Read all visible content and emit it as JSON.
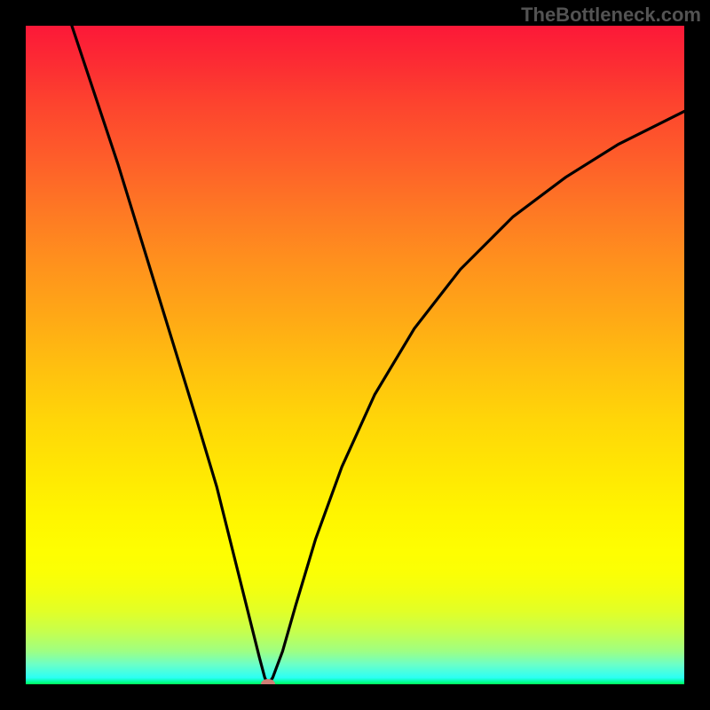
{
  "watermark": "TheBottleneck.com",
  "chart_data": {
    "type": "line",
    "title": "",
    "xlabel": "",
    "ylabel": "",
    "xlim": [
      0,
      100
    ],
    "ylim": [
      0,
      100
    ],
    "curve": [
      {
        "x": 7,
        "y": 100
      },
      {
        "x": 10,
        "y": 91
      },
      {
        "x": 14,
        "y": 79
      },
      {
        "x": 18,
        "y": 66
      },
      {
        "x": 22,
        "y": 53
      },
      {
        "x": 26,
        "y": 40
      },
      {
        "x": 29,
        "y": 30
      },
      {
        "x": 31,
        "y": 22
      },
      {
        "x": 33,
        "y": 14
      },
      {
        "x": 34.5,
        "y": 8
      },
      {
        "x": 35.5,
        "y": 4
      },
      {
        "x": 36.3,
        "y": 1
      },
      {
        "x": 36.8,
        "y": 0
      },
      {
        "x": 37.5,
        "y": 1
      },
      {
        "x": 39,
        "y": 5
      },
      {
        "x": 41,
        "y": 12
      },
      {
        "x": 44,
        "y": 22
      },
      {
        "x": 48,
        "y": 33
      },
      {
        "x": 53,
        "y": 44
      },
      {
        "x": 59,
        "y": 54
      },
      {
        "x": 66,
        "y": 63
      },
      {
        "x": 74,
        "y": 71
      },
      {
        "x": 82,
        "y": 77
      },
      {
        "x": 90,
        "y": 82
      },
      {
        "x": 96,
        "y": 85
      },
      {
        "x": 100,
        "y": 87
      }
    ],
    "marker": {
      "x": 36.8,
      "y": 0
    },
    "gradient_colors": {
      "top": "#fc1838",
      "mid": "#fffc00",
      "bottom": "#00fe56"
    }
  }
}
